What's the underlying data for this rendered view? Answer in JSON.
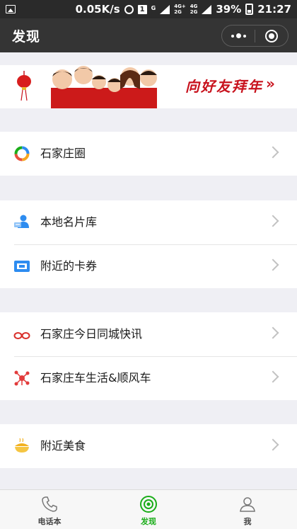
{
  "status_bar": {
    "net_speed": "0.05K/s",
    "notification_count": "1",
    "carrier_small": "G",
    "net_top": "4G+",
    "net_bottom": "2G",
    "net2_top": "4G",
    "net2_bottom": "2G",
    "battery": "39%",
    "time": "21:27"
  },
  "header": {
    "title": "发现"
  },
  "banner": {
    "text": "向好友拜年",
    "arrow": "»"
  },
  "sections": [
    {
      "items": [
        {
          "label": "石家庄圈",
          "icon": "ring-icon"
        }
      ]
    },
    {
      "items": [
        {
          "label": "本地名片库",
          "icon": "contact-card-icon"
        },
        {
          "label": "附近的卡券",
          "icon": "coupon-icon"
        }
      ]
    },
    {
      "items": [
        {
          "label": "石家庄今日同城快讯",
          "icon": "glasses-icon"
        },
        {
          "label": "石家庄车生活&顺风车",
          "icon": "network-icon"
        }
      ]
    },
    {
      "items": [
        {
          "label": "附近美食",
          "icon": "food-bowl-icon"
        }
      ]
    }
  ],
  "tabs": [
    {
      "label": "电话本",
      "icon": "phone-icon",
      "active": false
    },
    {
      "label": "发现",
      "icon": "discover-icon",
      "active": true
    },
    {
      "label": "我",
      "icon": "person-icon",
      "active": false
    }
  ],
  "colors": {
    "accent_green": "#1aad19",
    "banner_red": "#c8121d",
    "title_bar": "#343434",
    "background": "#efeff4"
  }
}
